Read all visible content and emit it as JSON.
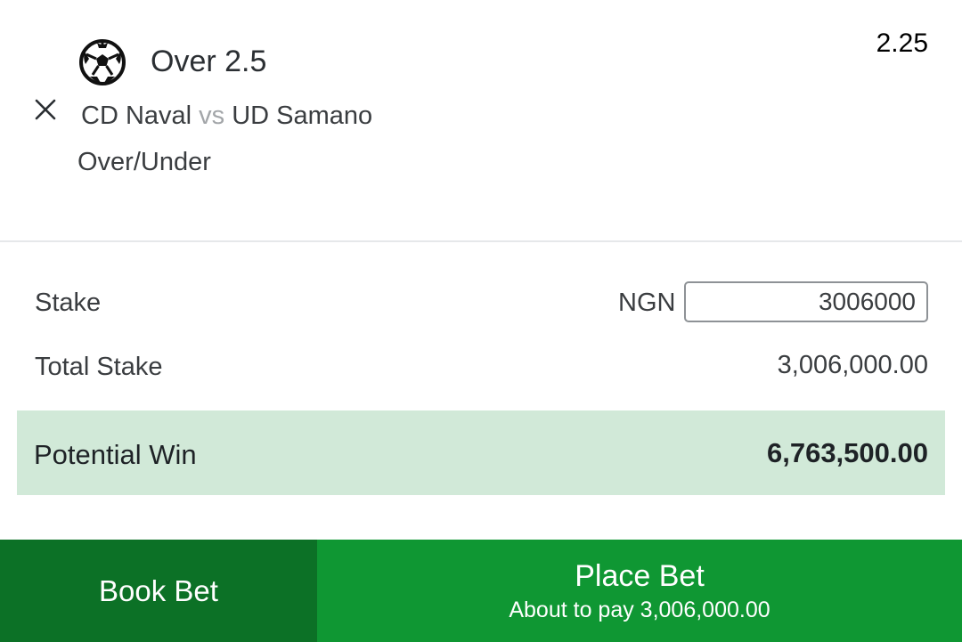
{
  "selection": {
    "sport_icon": "soccer-ball-icon",
    "title": "Over 2.5",
    "odds": "2.25",
    "remove_icon": "close-icon",
    "home_team": "CD Naval",
    "vs": "vs",
    "away_team": "UD Samano",
    "market": "Over/Under"
  },
  "stake": {
    "label": "Stake",
    "currency": "NGN",
    "value": "3006000"
  },
  "total_stake": {
    "label": "Total Stake",
    "value": "3,006,000.00"
  },
  "potential_win": {
    "label": "Potential Win",
    "value": "6,763,500.00"
  },
  "actions": {
    "book_bet_label": "Book Bet",
    "place_bet_label": "Place Bet",
    "place_bet_sub": "About to pay 3,006,000.00"
  },
  "colors": {
    "book_bet_bg": "#0c7126",
    "place_bet_bg": "#0f9733",
    "potential_win_bg": "#d1e9d8"
  }
}
